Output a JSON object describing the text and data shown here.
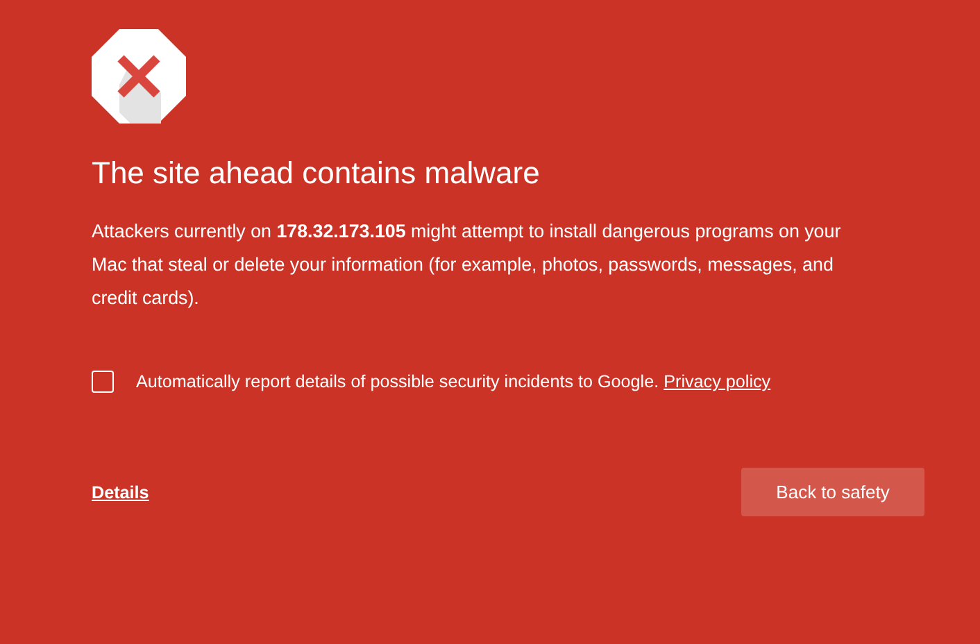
{
  "heading": "The site ahead contains malware",
  "message": "Attackers currently on **178.32.173.105** might attempt to install dangerous programs on your Mac that steal or delete your information (for example, photos, passwords, messages, and credit cards).",
  "report_option": {
    "label": "Automatically report details of possible security incidents to Google.",
    "link": "Privacy policy",
    "checked": false
  },
  "details_link": "Details",
  "back_button": "Back to safety"
}
